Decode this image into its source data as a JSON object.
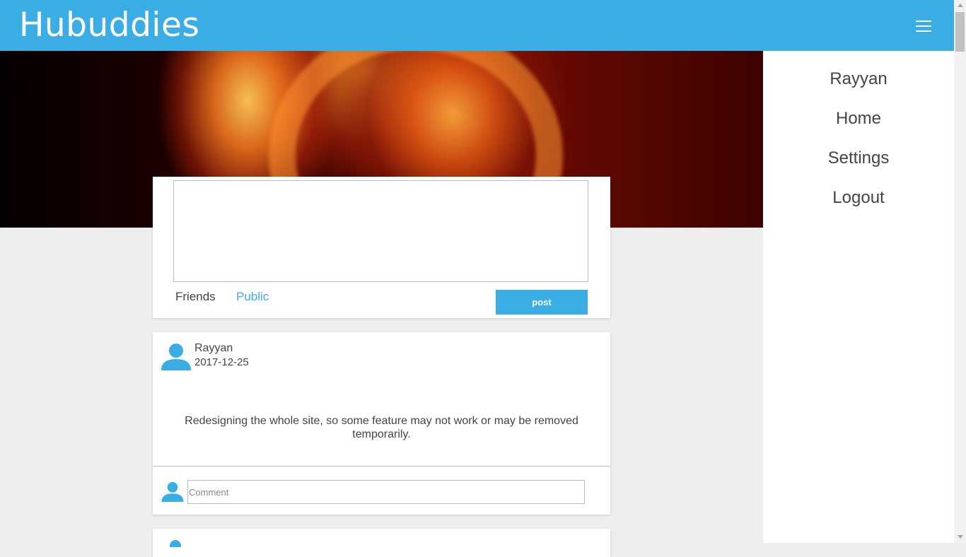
{
  "header": {
    "brand": "Hubuddies",
    "menu_icon": "hamburger-icon",
    "bg_color": "#3badE5"
  },
  "side_menu": {
    "items": [
      {
        "label": "Rayyan"
      },
      {
        "label": "Home"
      },
      {
        "label": "Settings"
      },
      {
        "label": "Logout"
      }
    ]
  },
  "composer": {
    "text": "",
    "audience_options": [
      "Friends",
      "Public"
    ],
    "selected_audience": "Public",
    "post_label": "post"
  },
  "posts": [
    {
      "author": "Rayyan",
      "date": "2017-12-25",
      "text": "Redesigning the whole site, so some feature may not work or may be removed temporarily.",
      "comment_placeholder": "Comment"
    }
  ],
  "colors": {
    "accent": "#3badE5",
    "page_bg": "#eeeeee"
  }
}
